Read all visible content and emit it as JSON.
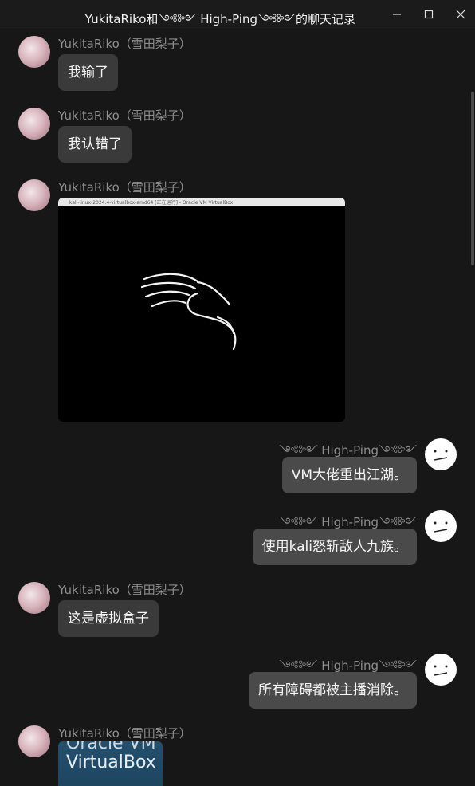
{
  "window": {
    "title": "YukitaRiko和༺༻ High-Ping༺༻的聊天记录",
    "min_icon": "minimize-icon",
    "max_icon": "maximize-icon",
    "close_icon": "close-icon"
  },
  "sender_left": "YukitaRiko（雪田梨子）",
  "sender_right": "༺༻ High-Ping༺༻",
  "messages": [
    {
      "text": "我输了"
    },
    {
      "text": "我认错了"
    },
    {
      "image": "kali-screenshot",
      "caption": "kali-linux-2024.4-virtualbox-amd64 [正在运行] - Oracle VM VirtualBox"
    },
    {
      "text": "VM大佬重出江湖。"
    },
    {
      "text": "使用kali怒斩敌人九族。"
    },
    {
      "text": "这是虚拟盒子"
    },
    {
      "text": "所有障碍都被主播消除。"
    },
    {
      "image": "virtualbox-logo",
      "line1": "Oracle VM",
      "line2": "VirtualBox"
    }
  ],
  "colors": {
    "background": "#171717",
    "bubble": "#3a3a3a",
    "name": "#8e8e8e"
  }
}
